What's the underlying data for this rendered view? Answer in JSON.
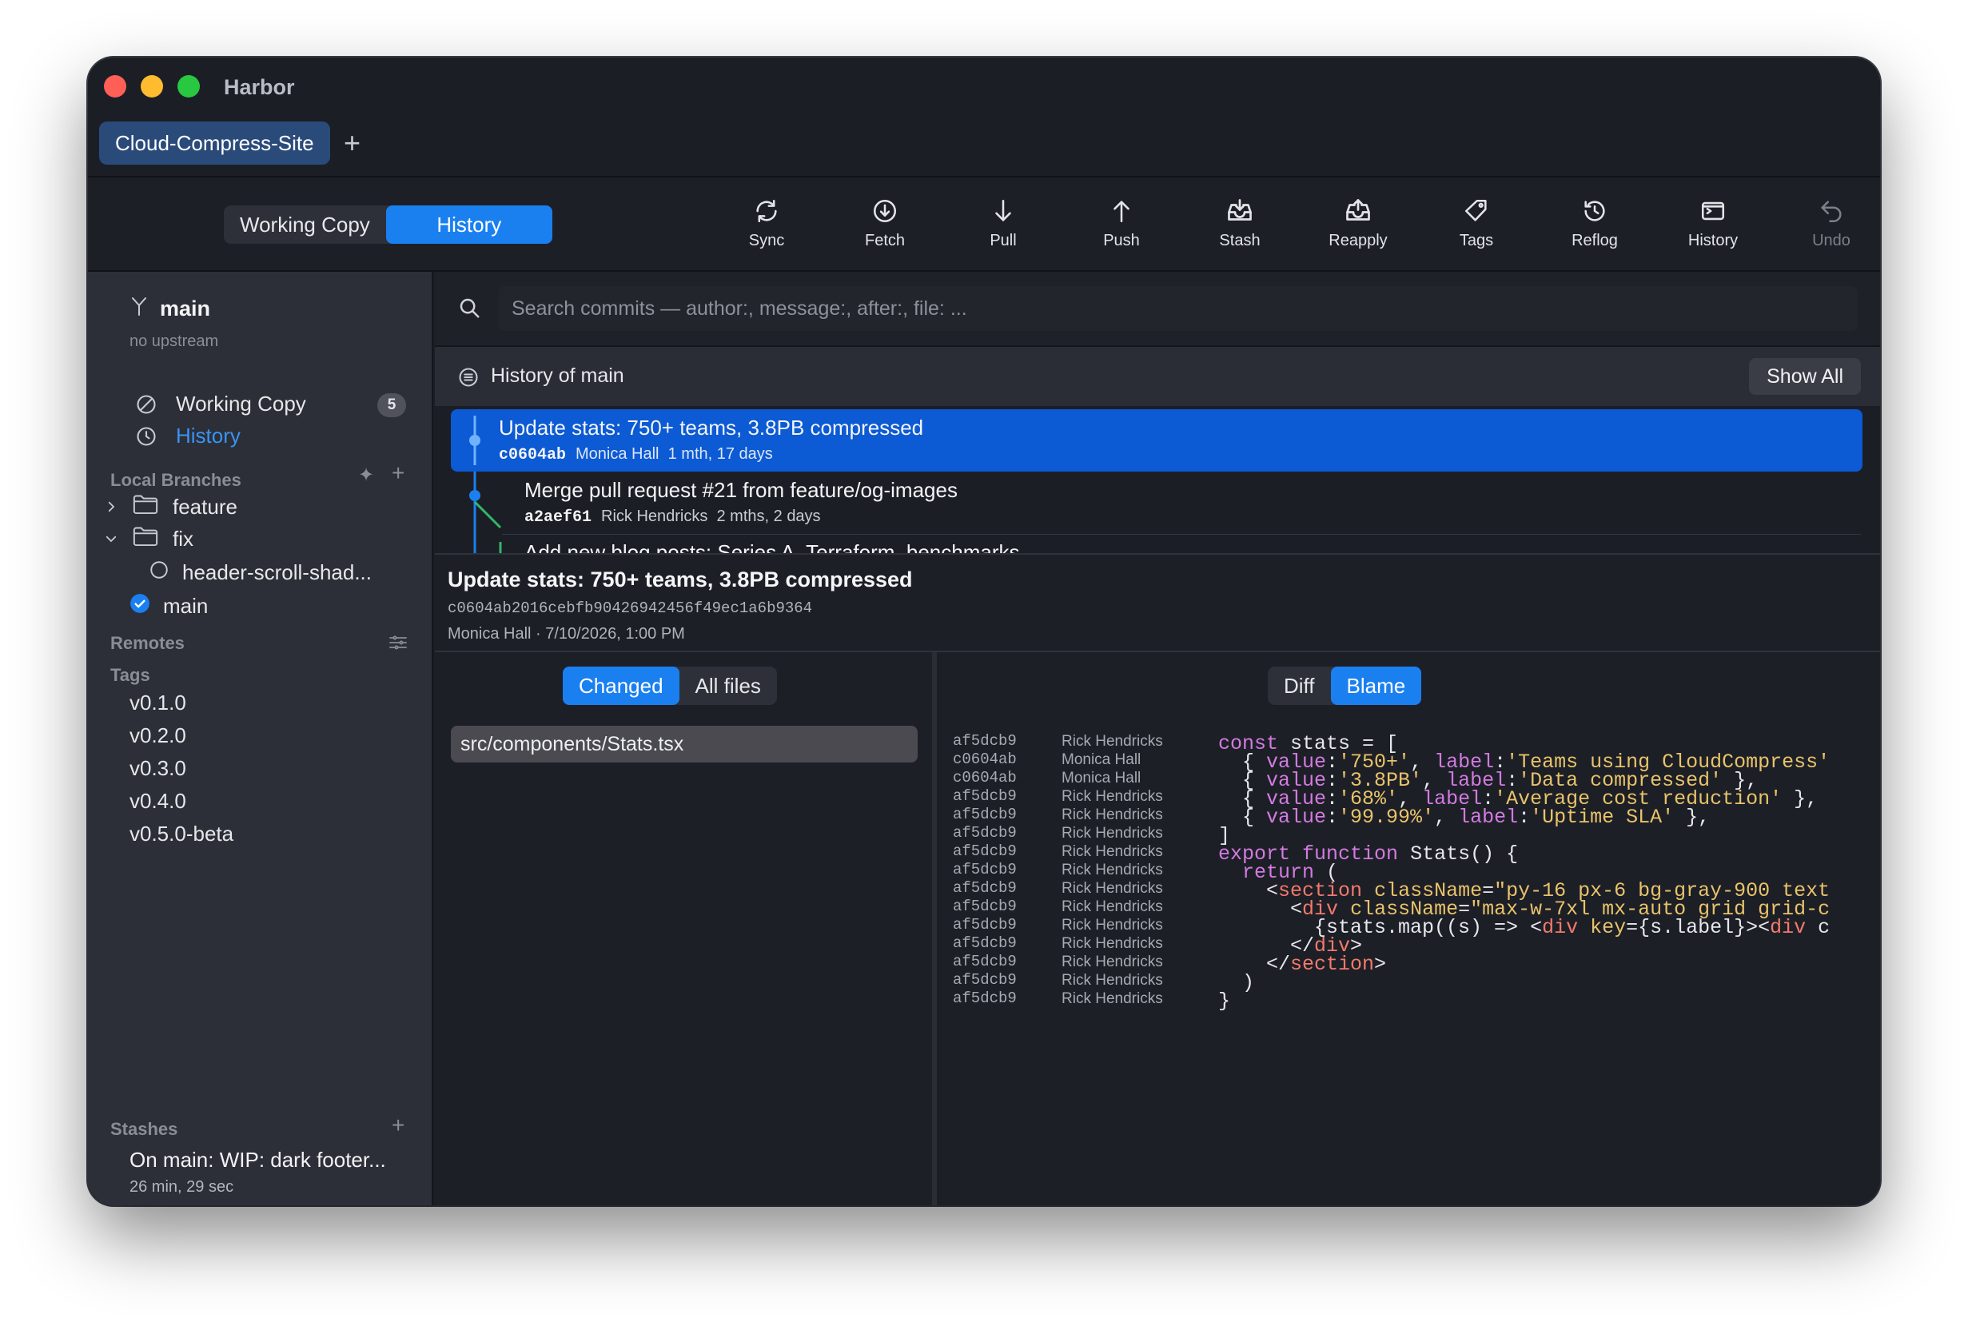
{
  "window": {
    "app_title": "Harbor",
    "tab_label": "Cloud-Compress-Site",
    "tab_add": "+"
  },
  "toolbar": {
    "views": [
      "Working Copy",
      "History"
    ],
    "active_view": "History",
    "tools": [
      {
        "label": "Sync",
        "icon": "sync-icon"
      },
      {
        "label": "Fetch",
        "icon": "fetch-icon"
      },
      {
        "label": "Pull",
        "icon": "pull-icon"
      },
      {
        "label": "Push",
        "icon": "push-icon"
      },
      {
        "label": "Stash",
        "icon": "stash-icon"
      },
      {
        "label": "Reapply",
        "icon": "reapply-icon"
      },
      {
        "label": "Tags",
        "icon": "tag-icon"
      },
      {
        "label": "Reflog",
        "icon": "reflog-icon"
      },
      {
        "label": "History",
        "icon": "terminal-icon"
      },
      {
        "label": "Undo",
        "icon": "undo-icon"
      }
    ]
  },
  "sidebar": {
    "branch": "main",
    "upstream": "no upstream",
    "nav": [
      {
        "label": "Working Copy",
        "badge": "5"
      },
      {
        "label": "History"
      }
    ],
    "local_branches_header": "Local Branches",
    "folders": [
      {
        "label": "feature",
        "expanded": false
      },
      {
        "label": "fix",
        "expanded": true
      }
    ],
    "fix_branch": "header-scroll-shad...",
    "current_branch": "main",
    "remotes_header": "Remotes",
    "tags_header": "Tags",
    "tags": [
      "v0.1.0",
      "v0.2.0",
      "v0.3.0",
      "v0.4.0",
      "v0.5.0-beta"
    ],
    "stashes_header": "Stashes",
    "stash": {
      "title": "On main: WIP: dark footer...",
      "time": "26 min, 29 sec"
    }
  },
  "search": {
    "placeholder": "Search commits — author:, message:, after:, file: ..."
  },
  "history": {
    "title": "History of main",
    "show_all": "Show All",
    "commits": [
      {
        "subject": "Update stats: 750+ teams, 3.8PB compressed",
        "hash": "c0604ab",
        "author": "Monica Hall",
        "age": "1 mth, 17 days"
      },
      {
        "subject": "Merge pull request #21 from feature/og-images",
        "hash": "a2aef61",
        "author": "Rick Hendricks",
        "age": "2 mths, 2 days"
      },
      {
        "subject": "Add new blog posts: Series A, Terraform, benchmarks",
        "hash": "",
        "author": "",
        "age": ""
      }
    ]
  },
  "detail": {
    "title": "Update stats: 750+ teams, 3.8PB compressed",
    "sha": "c0604ab2016cebfb90426942456f49ec1a6b9364",
    "author_line": "Monica Hall · 7/10/2026, 1:00 PM"
  },
  "files": {
    "tabs": [
      "Changed",
      "All files"
    ],
    "active_tab": "Changed",
    "items": [
      "src/components/Stats.tsx"
    ]
  },
  "code_view": {
    "tabs": [
      "Diff",
      "Blame"
    ],
    "active_tab": "Blame",
    "lines": [
      {
        "hash": "af5dcb9",
        "author": "Rick Hendricks"
      },
      {
        "hash": "c0604ab",
        "author": "Monica Hall"
      },
      {
        "hash": "c0604ab",
        "author": "Monica Hall"
      },
      {
        "hash": "af5dcb9",
        "author": "Rick Hendricks"
      },
      {
        "hash": "af5dcb9",
        "author": "Rick Hendricks"
      },
      {
        "hash": "af5dcb9",
        "author": "Rick Hendricks"
      },
      {
        "hash": "af5dcb9",
        "author": "Rick Hendricks"
      },
      {
        "hash": "af5dcb9",
        "author": "Rick Hendricks"
      },
      {
        "hash": "af5dcb9",
        "author": "Rick Hendricks"
      },
      {
        "hash": "af5dcb9",
        "author": "Rick Hendricks"
      },
      {
        "hash": "af5dcb9",
        "author": "Rick Hendricks"
      },
      {
        "hash": "af5dcb9",
        "author": "Rick Hendricks"
      },
      {
        "hash": "af5dcb9",
        "author": "Rick Hendricks"
      },
      {
        "hash": "af5dcb9",
        "author": "Rick Hendricks"
      },
      {
        "hash": "af5dcb9",
        "author": "Rick Hendricks"
      }
    ],
    "code": [
      [
        {
          "t": "const",
          "c": "kw"
        },
        {
          "t": " stats = ["
        }
      ],
      [
        {
          "t": "  { "
        },
        {
          "t": "value",
          "c": "kw"
        },
        {
          "t": ":"
        },
        {
          "t": "'750+'",
          "c": "str"
        },
        {
          "t": ", "
        },
        {
          "t": "label",
          "c": "kw"
        },
        {
          "t": ":"
        },
        {
          "t": "'Teams using CloudCompress'",
          "c": "str"
        }
      ],
      [
        {
          "t": "  { "
        },
        {
          "t": "value",
          "c": "kw"
        },
        {
          "t": ":"
        },
        {
          "t": "'3.8PB'",
          "c": "str"
        },
        {
          "t": ", "
        },
        {
          "t": "label",
          "c": "kw"
        },
        {
          "t": ":"
        },
        {
          "t": "'Data compressed'",
          "c": "str"
        },
        {
          "t": " },"
        }
      ],
      [
        {
          "t": "  { "
        },
        {
          "t": "value",
          "c": "kw"
        },
        {
          "t": ":"
        },
        {
          "t": "'68%'",
          "c": "str"
        },
        {
          "t": ", "
        },
        {
          "t": "label",
          "c": "kw"
        },
        {
          "t": ":"
        },
        {
          "t": "'Average cost reduction'",
          "c": "str"
        },
        {
          "t": " },"
        }
      ],
      [
        {
          "t": "  { "
        },
        {
          "t": "value",
          "c": "kw"
        },
        {
          "t": ":"
        },
        {
          "t": "'99.99%'",
          "c": "str"
        },
        {
          "t": ", "
        },
        {
          "t": "label",
          "c": "kw"
        },
        {
          "t": ":"
        },
        {
          "t": "'Uptime SLA'",
          "c": "str"
        },
        {
          "t": " },"
        }
      ],
      [
        {
          "t": "]"
        }
      ],
      [
        {
          "t": "export",
          "c": "kw"
        },
        {
          "t": " "
        },
        {
          "t": "function",
          "c": "kw"
        },
        {
          "t": " Stats() {"
        }
      ],
      [
        {
          "t": "  "
        },
        {
          "t": "return",
          "c": "kw"
        },
        {
          "t": " ("
        }
      ],
      [
        {
          "t": "    <"
        },
        {
          "t": "section",
          "c": "tag-c"
        },
        {
          "t": " "
        },
        {
          "t": "className",
          "c": "attr-c"
        },
        {
          "t": "="
        },
        {
          "t": "\"py-16 px-6 bg-gray-900 text",
          "c": "str"
        }
      ],
      [
        {
          "t": "      <"
        },
        {
          "t": "div",
          "c": "tag-c"
        },
        {
          "t": " "
        },
        {
          "t": "className",
          "c": "attr-c"
        },
        {
          "t": "="
        },
        {
          "t": "\"max-w-7xl mx-auto grid grid-c",
          "c": "str"
        }
      ],
      [
        {
          "t": "        {stats.map((s) => <"
        },
        {
          "t": "div",
          "c": "tag-c"
        },
        {
          "t": " "
        },
        {
          "t": "key",
          "c": "attr-c"
        },
        {
          "t": "={s.label}><"
        },
        {
          "t": "div",
          "c": "tag-c"
        },
        {
          "t": " c"
        }
      ],
      [
        {
          "t": "      </"
        },
        {
          "t": "div",
          "c": "tag-c"
        },
        {
          "t": ">"
        }
      ],
      [
        {
          "t": "    </"
        },
        {
          "t": "section",
          "c": "tag-c"
        },
        {
          "t": ">"
        }
      ],
      [
        {
          "t": "  )"
        }
      ],
      [
        {
          "t": "}"
        }
      ]
    ]
  }
}
